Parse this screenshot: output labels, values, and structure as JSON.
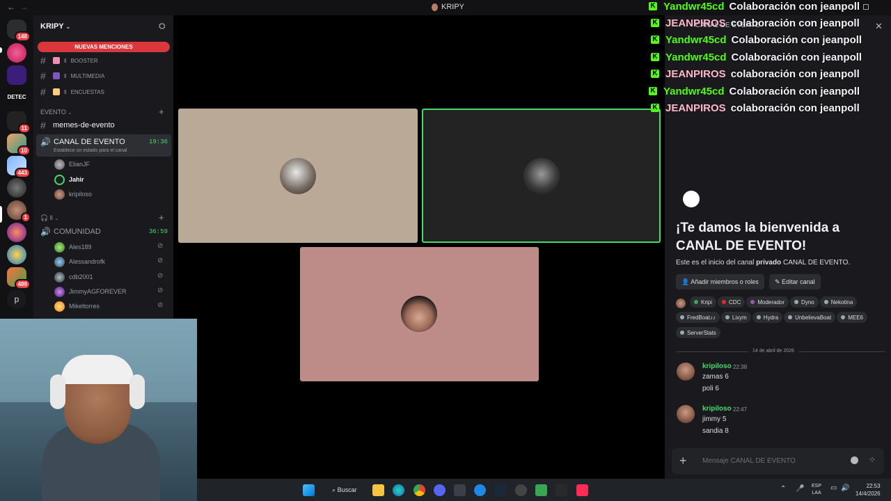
{
  "window": {
    "title": "KRIPY",
    "back_glyph": "←",
    "forward_glyph": "→"
  },
  "rail": {
    "badges": [
      "148",
      "11",
      "10",
      "443",
      "1",
      "489"
    ],
    "letter_server": "p"
  },
  "sidebar": {
    "guild_name": "KRIPY",
    "new_mentions": "NUEVAS MENCIONES",
    "top_channels": [
      {
        "label": "BOOSTER",
        "prefix": "ll"
      },
      {
        "label": "MULTIMEDIA",
        "prefix": "ll"
      },
      {
        "label": "ENCUESTAS",
        "prefix": "ll"
      }
    ],
    "category_evento": "EVENTO",
    "memes_channel": "memes-de-evento",
    "voice_channel": {
      "name": "CANAL DE EVENTO",
      "timer": "19:36",
      "status_hint": "Establece un estado para el canal"
    },
    "voice_members": [
      "ElianJF",
      "Jahir",
      "kripiloso"
    ],
    "category_2": "ll",
    "community": {
      "name": "COMUNIDAD",
      "timer": "36:59"
    },
    "community_members": [
      "Ales189",
      "Alessandrofk",
      "cdb2001",
      "JimmyAGFOREVER",
      "Mikeltorres"
    ]
  },
  "chat_overlay": [
    {
      "user": "Yandwr45cd",
      "msg": "Colaboración con jeanpoll",
      "color": "#53fc18"
    },
    {
      "user": "JEANPIROS",
      "msg": "colaboración con jeanpoll",
      "color": "#ffb6c8"
    },
    {
      "user": "Yandwr45cd",
      "msg": "Colaboración con jeanpoll",
      "color": "#53fc18"
    },
    {
      "user": "Yandwr45cd",
      "msg": "Colaboración con jeanpoll",
      "color": "#53fc18"
    },
    {
      "user": "JEANPIROS",
      "msg": "colaboración con jeanpoll",
      "color": "#ffb6c8"
    },
    {
      "user": "Yandwr45cd",
      "msg": "Colaboración con jeanpoll",
      "color": "#53fc18"
    },
    {
      "user": "JEANPIROS",
      "msg": "colaboración con jeanpoll",
      "color": "#ffb6c8"
    }
  ],
  "chat_panel": {
    "header_channel": "CANAL DE EVENTO",
    "welcome_title": "¡Te damos la bienvenida a CANAL DE EVENTO!",
    "intro_prefix": "Este es el inicio del canal ",
    "intro_private": "privado",
    "intro_channel": " CANAL DE  EVENTO.",
    "add_members": "Añadir miembros o roles",
    "edit_channel": "Editar canal",
    "roles": [
      {
        "name": "Kripi",
        "color": "#3ba55c"
      },
      {
        "name": "CDC",
        "color": "#e02b2b"
      },
      {
        "name": "Moderador",
        "color": "#9b59b6"
      },
      {
        "name": "Dyno",
        "color": "#99aab5"
      },
      {
        "name": "Nekotina",
        "color": "#99aab5"
      },
      {
        "name": "FredBoat♪♪",
        "color": "#99aab5"
      },
      {
        "name": "Lixym",
        "color": "#99aab5"
      },
      {
        "name": "Hydra",
        "color": "#99aab5"
      },
      {
        "name": "UnbelievaBoat",
        "color": "#99aab5"
      },
      {
        "name": "MEE6",
        "color": "#99aab5"
      },
      {
        "name": "ServerStats",
        "color": "#99aab5"
      }
    ],
    "date_divider": "14 de abril de 2026",
    "messages": [
      {
        "user": "kripiloso",
        "time": "22:38",
        "lines": [
          "zamas 6",
          "poli 6"
        ]
      },
      {
        "user": "kripiloso",
        "time": "22:47",
        "lines": [
          "jimmy 5",
          "sandia 8"
        ]
      }
    ],
    "input_placeholder": "Mensaje CANAL DE EVENTO"
  },
  "taskbar": {
    "search_label": "Buscar",
    "lang_top": "ESP",
    "lang_bottom": "LAA",
    "clock_time": "22:53",
    "clock_date": "14/4/2026"
  }
}
